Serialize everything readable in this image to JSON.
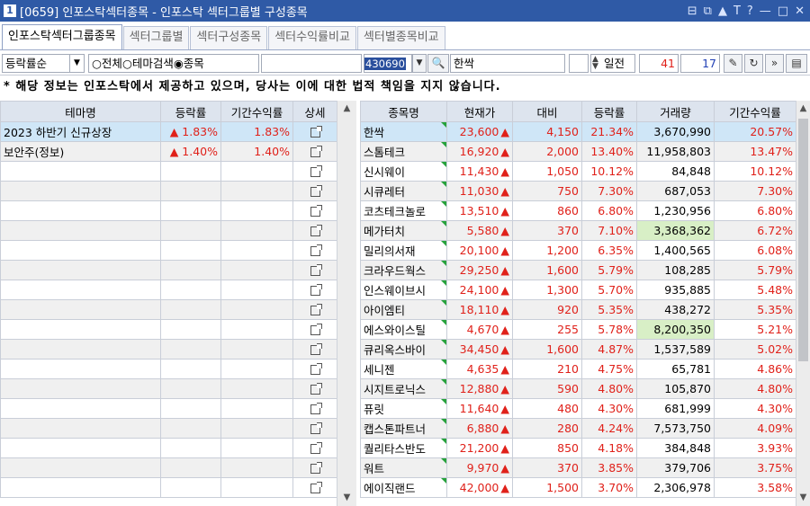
{
  "window": {
    "number": "1",
    "title": "[0659] 인포스탁섹터종목 - 인포스탁 섹터그룹별 구성종목",
    "controls": [
      "⊟",
      "⧉",
      "▲",
      "T",
      "?",
      "—",
      "□",
      "✕"
    ]
  },
  "tabs": [
    {
      "label": "인포스탁섹터그룹종목",
      "active": true
    },
    {
      "label": "섹터그룹별",
      "active": false
    },
    {
      "label": "섹터구성종목",
      "active": false
    },
    {
      "label": "섹터수익률비교",
      "active": false
    },
    {
      "label": "섹터별종목비교",
      "active": false
    }
  ],
  "toolbar": {
    "sort_select": "등락률순",
    "radio_all": "전체",
    "radio_theme": "테마검색",
    "radio_stock": "종목",
    "stock_code": "430690",
    "stock_name": "한싹",
    "period_label": "일전",
    "period_from": "41",
    "period_to": "17"
  },
  "notice": "* 해당 정보는 인포스탁에서 제공하고 있으며, 당사는 이에 대한 법적 책임을 지지 않습니다.",
  "left_table": {
    "columns": [
      "테마명",
      "등락률",
      "기간수익률",
      "상세"
    ],
    "rows": [
      {
        "theme": "2023 하반기 신규상장",
        "change": "▲  1.83%",
        "period": "1.83%"
      },
      {
        "theme": "보안주(정보)",
        "change": "▲  1.40%",
        "period": "1.40%"
      }
    ],
    "empty_rows": 17
  },
  "right_table": {
    "columns": [
      "종목명",
      "현재가",
      "대비",
      "등락률",
      "거래량",
      "기간수익률"
    ],
    "rows": [
      {
        "name": "한싹",
        "price": "23,600",
        "diff": "4,150",
        "rate": "21.34%",
        "volume": "3,670,990",
        "period": "20.57%"
      },
      {
        "name": "스톰테크",
        "price": "16,920",
        "diff": "2,000",
        "rate": "13.40%",
        "volume": "11,958,803",
        "period": "13.47%"
      },
      {
        "name": "신시웨이",
        "price": "11,430",
        "diff": "1,050",
        "rate": "10.12%",
        "volume": "84,848",
        "period": "10.12%"
      },
      {
        "name": "시큐레터",
        "price": "11,030",
        "diff": "750",
        "rate": "7.30%",
        "volume": "687,053",
        "period": "7.30%"
      },
      {
        "name": "코츠테크놀로",
        "price": "13,510",
        "diff": "860",
        "rate": "6.80%",
        "volume": "1,230,956",
        "period": "6.80%"
      },
      {
        "name": "메가터치",
        "price": "5,580",
        "diff": "370",
        "rate": "7.10%",
        "volume": "3,368,362",
        "period": "6.72%"
      },
      {
        "name": "밀리의서재",
        "price": "20,100",
        "diff": "1,200",
        "rate": "6.35%",
        "volume": "1,400,565",
        "period": "6.08%"
      },
      {
        "name": "크라우드웍스",
        "price": "29,250",
        "diff": "1,600",
        "rate": "5.79%",
        "volume": "108,285",
        "period": "5.79%"
      },
      {
        "name": "인스웨이브시",
        "price": "24,100",
        "diff": "1,300",
        "rate": "5.70%",
        "volume": "935,885",
        "period": "5.48%"
      },
      {
        "name": "아이엠티",
        "price": "18,110",
        "diff": "920",
        "rate": "5.35%",
        "volume": "438,272",
        "period": "5.35%"
      },
      {
        "name": "에스와이스틸",
        "price": "4,670",
        "diff": "255",
        "rate": "5.78%",
        "volume": "8,200,350",
        "period": "5.21%"
      },
      {
        "name": "큐리옥스바이",
        "price": "34,450",
        "diff": "1,600",
        "rate": "4.87%",
        "volume": "1,537,589",
        "period": "5.02%"
      },
      {
        "name": "세니젠",
        "price": "4,635",
        "diff": "210",
        "rate": "4.75%",
        "volume": "65,781",
        "period": "4.86%"
      },
      {
        "name": "시지트로닉스",
        "price": "12,880",
        "diff": "590",
        "rate": "4.80%",
        "volume": "105,870",
        "period": "4.80%"
      },
      {
        "name": "퓨릿",
        "price": "11,640",
        "diff": "480",
        "rate": "4.30%",
        "volume": "681,999",
        "period": "4.30%"
      },
      {
        "name": "캡스톤파트너",
        "price": "6,880",
        "diff": "280",
        "rate": "4.24%",
        "volume": "7,573,750",
        "period": "4.09%"
      },
      {
        "name": "퀄리타스반도",
        "price": "21,200",
        "diff": "850",
        "rate": "4.18%",
        "volume": "384,848",
        "period": "3.93%"
      },
      {
        "name": "워트",
        "price": "9,970",
        "diff": "370",
        "rate": "3.85%",
        "volume": "379,706",
        "period": "3.75%"
      },
      {
        "name": "에이직랜드",
        "price": "42,000",
        "diff": "1,500",
        "rate": "3.70%",
        "volume": "2,306,978",
        "period": "3.58%"
      }
    ],
    "highlighted_volumes": [
      5,
      10
    ]
  },
  "colors": {
    "title_bar": "#2f5aa6",
    "up": "#e0211a",
    "selected_row": "#cfe6f7",
    "volume_highlight": "#d8efc6"
  }
}
